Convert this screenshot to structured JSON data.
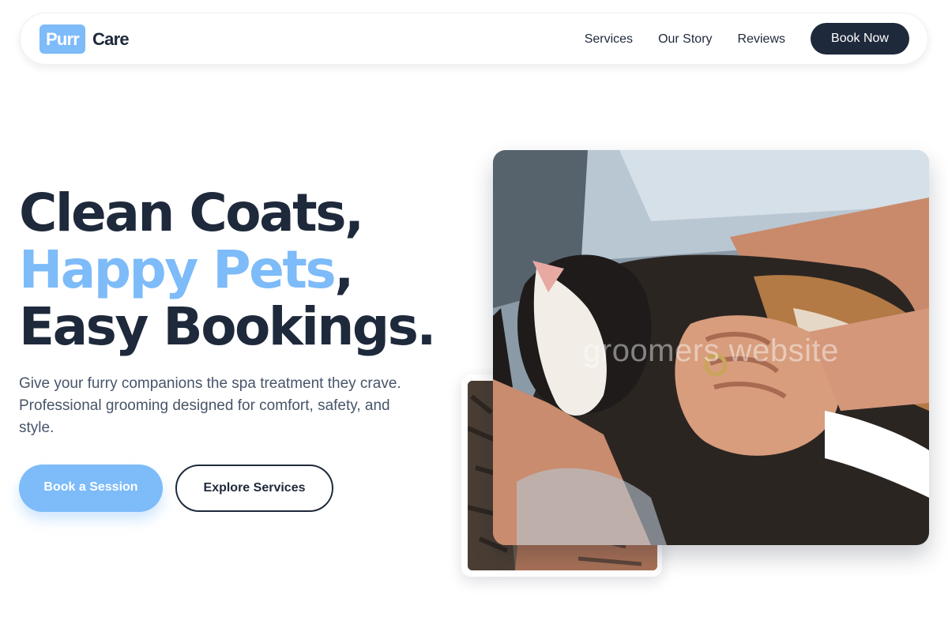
{
  "brand": {
    "badge": "Purr",
    "name": "Care"
  },
  "nav": {
    "links": [
      {
        "label": "Services"
      },
      {
        "label": "Our Story"
      },
      {
        "label": "Reviews"
      }
    ],
    "cta": "Book Now"
  },
  "hero": {
    "title_line1": "Clean Coats,",
    "title_line2_accent": "Happy Pets",
    "title_line2_suffix": ",",
    "title_line3": "Easy Bookings.",
    "description": "Give your furry companions the spa treatment they crave. Professional grooming designed for comfort, safety, and style.",
    "primary_button": "Book a Session",
    "secondary_button": "Explore Services",
    "watermark": "groomers website"
  },
  "colors": {
    "accent": "#7dbbf9",
    "dark": "#1e293b",
    "muted": "#475569"
  }
}
